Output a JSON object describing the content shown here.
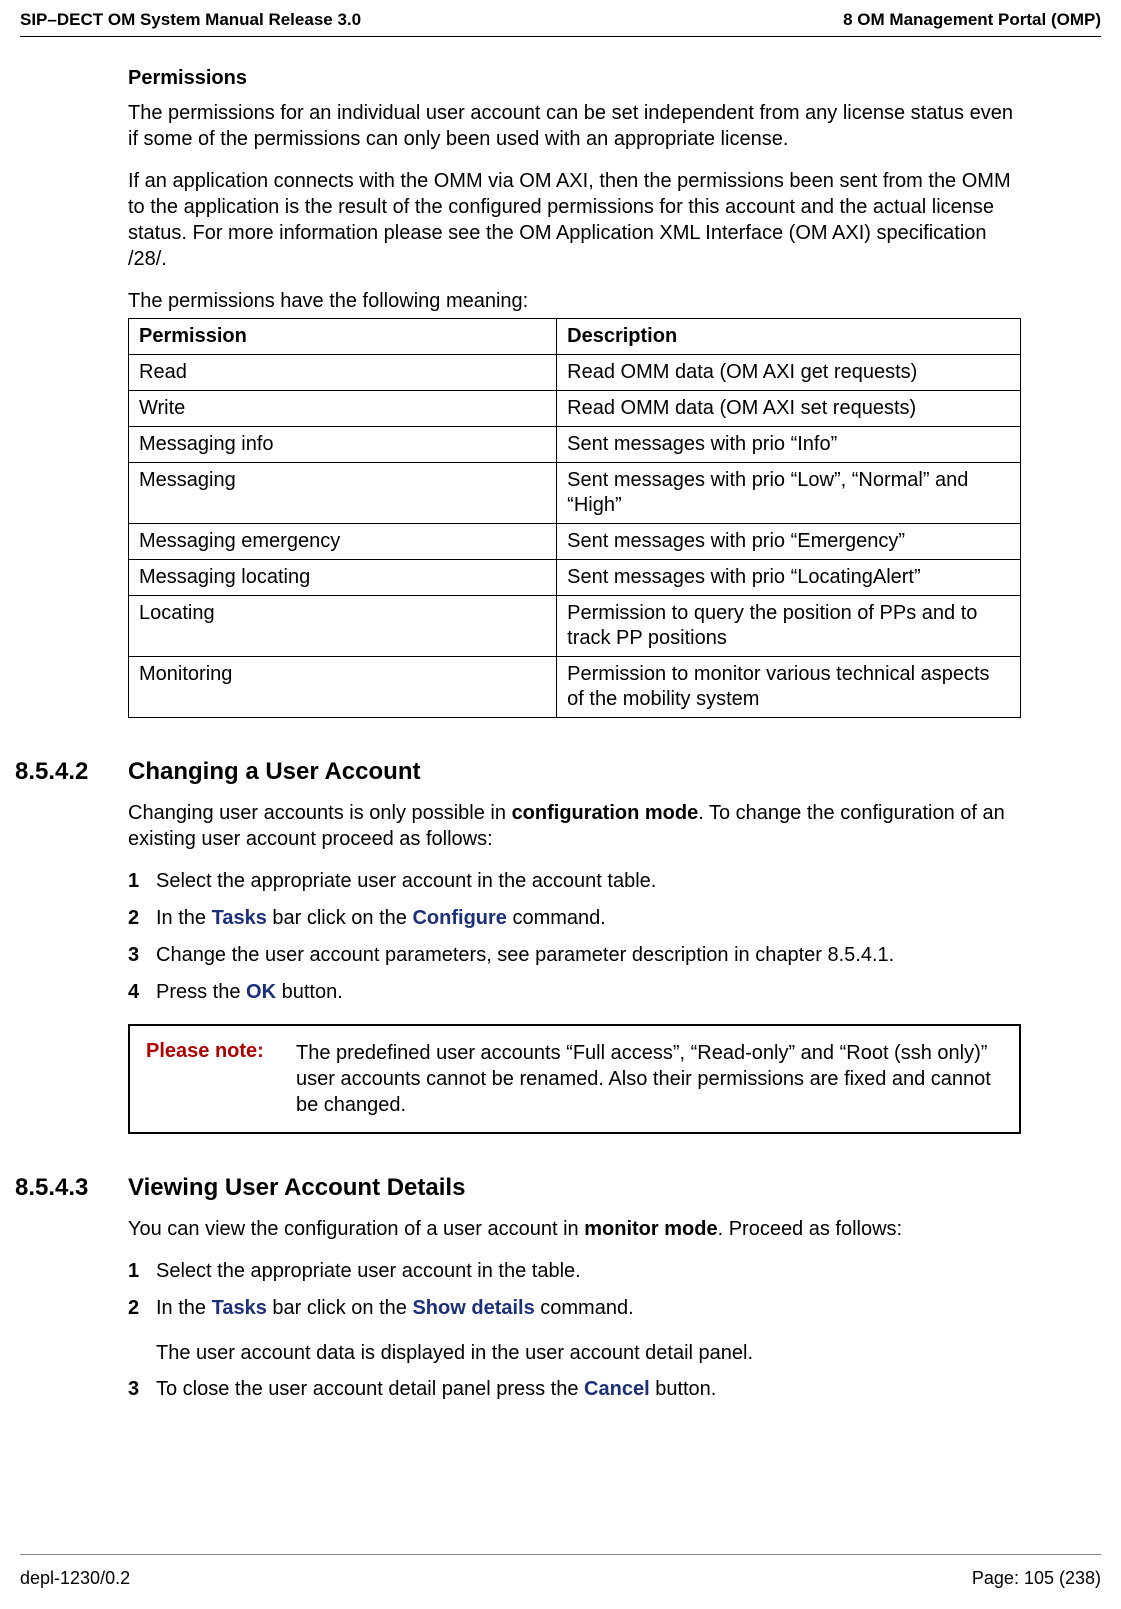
{
  "header": {
    "left": "SIP–DECT OM System Manual Release 3.0",
    "right": "8 OM Management Portal (OMP)"
  },
  "footer": {
    "left": "depl-1230/0.2",
    "right": "Page: 105 (238)"
  },
  "permissions": {
    "title": "Permissions",
    "para1": "The permissions for an individual user account can be set independent from any license status even if some of the permissions can only been used with an appropriate license.",
    "para2": "If an application connects with the OMM via OM AXI, then the permissions been sent from the OMM to the application is the result of the configured permissions for this account and the actual license status. For more information please see the OM Application XML Interface (OM AXI) specification /28/.",
    "para3": "The permissions have the following meaning:",
    "th1": "Permission",
    "th2": "Description",
    "rows": [
      {
        "p": "Read",
        "d": "Read OMM data (OM AXI get requests)"
      },
      {
        "p": "Write",
        "d": "Read OMM data (OM AXI set requests)"
      },
      {
        "p": "Messaging info",
        "d": "Sent messages with prio “Info”"
      },
      {
        "p": "Messaging",
        "d": "Sent messages with prio “Low”, “Normal” and “High”"
      },
      {
        "p": "Messaging emergency",
        "d": "Sent messages with prio “Emergency”"
      },
      {
        "p": "Messaging locating",
        "d": "Sent messages with prio “LocatingAlert”"
      },
      {
        "p": "Locating",
        "d": "Permission to query the position of PPs and to track PP positions"
      },
      {
        "p": "Monitoring",
        "d": "Permission to monitor various technical aspects of the mobility system"
      }
    ]
  },
  "sec8542": {
    "num": "8.5.4.2",
    "title": "Changing a User Account",
    "intro_a": "Changing user accounts is only possible in ",
    "intro_bold": "configuration mode",
    "intro_b": ". To change the configuration of an existing user account proceed as follows:",
    "items": {
      "i1": {
        "n": "1",
        "t": "Select the appropriate user account in the account table."
      },
      "i2": {
        "n": "2",
        "a": "In the ",
        "l1": "Tasks",
        "b": " bar click on the ",
        "l2": "Configure",
        "c": " command."
      },
      "i3": {
        "n": "3",
        "t": "Change the user account parameters, see parameter description in chapter 8.5.4.1."
      },
      "i4": {
        "n": "4",
        "a": "Press the ",
        "l1": "OK",
        "b": " button."
      }
    },
    "note": {
      "label": "Please note:",
      "text": "The predefined user accounts “Full access”, “Read-only” and “Root (ssh only)” user accounts cannot be renamed. Also their permissions are fixed and cannot be changed."
    }
  },
  "sec8543": {
    "num": "8.5.4.3",
    "title": "Viewing User Account Details",
    "intro_a": "You can view the configuration of a user account in ",
    "intro_bold": "monitor mode",
    "intro_b": ". Proceed as follows:",
    "items": {
      "i1": {
        "n": "1",
        "t": "Select the appropriate user account in the table."
      },
      "i2": {
        "n": "2",
        "a": "In the ",
        "l1": "Tasks",
        "b": " bar click on the ",
        "l2": "Show details",
        "c": " command."
      },
      "i2sub": "The user account data is displayed in the user account detail panel.",
      "i3": {
        "n": "3",
        "a": "To close the user account detail panel press the ",
        "l1": "Cancel",
        "b": " button."
      }
    }
  }
}
